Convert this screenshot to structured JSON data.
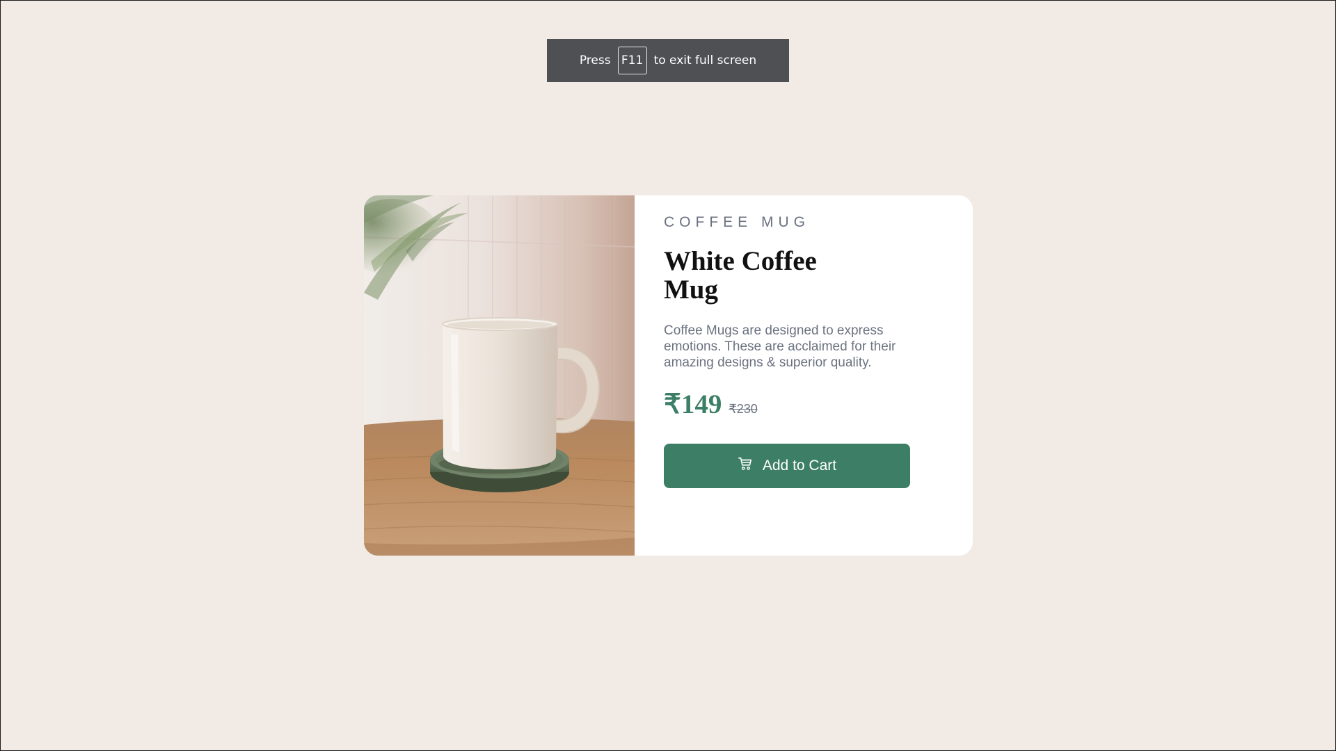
{
  "fullscreen_notice": {
    "prefix": "Press",
    "key": "F11",
    "suffix": "to exit full screen"
  },
  "product": {
    "category": "COFFEE MUG",
    "title": "White Coffee Mug",
    "description": "Coffee Mugs are designed to express emotions. These are acclaimed for their amazing designs & superior quality.",
    "price": "₹149",
    "original_price": "₹230",
    "add_to_cart_label": "Add to Cart",
    "image_icon": "coffee-mug-photo",
    "cart_icon": "shopping-cart-icon"
  },
  "colors": {
    "page_background": "#f2ebe5",
    "accent": "#3d7f66",
    "muted_text": "#6b7280",
    "toast_background": "#4f5054"
  }
}
